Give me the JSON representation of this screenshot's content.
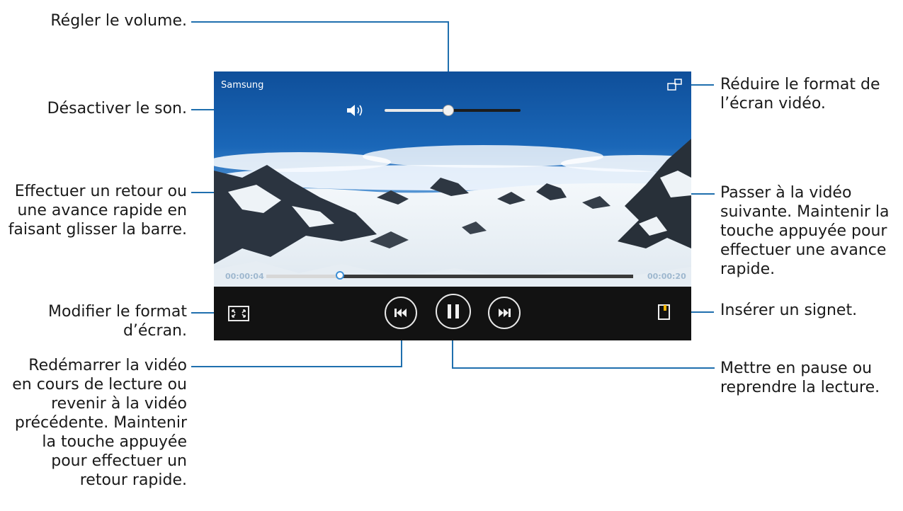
{
  "annotations": {
    "volume": "Régler le volume.",
    "mute": "Désactiver le son.",
    "seek": [
      "Effectuer un retour ou",
      "une avance rapide en",
      "faisant glisser la barre."
    ],
    "aspect": [
      "Modifier le format",
      "d’écran."
    ],
    "previous": [
      "Redémarrer la vidéo",
      "en cours de lecture ou",
      "revenir à la vidéo",
      "précédente. Maintenir",
      "la touche appuyée",
      "pour effectuer un",
      "retour rapide."
    ],
    "popup": [
      "Réduire le format de",
      "l’écran vidéo."
    ],
    "next": [
      "Passer à la vidéo",
      "suivante. Maintenir la",
      "touche appuyée pour",
      "effectuer une avance",
      "rapide."
    ],
    "bookmark": "Insérer un signet.",
    "pause": [
      "Mettre en pause ou",
      "reprendre la lecture."
    ]
  },
  "player": {
    "title": "Samsung",
    "elapsed": "00:00:04",
    "duration": "00:00:20",
    "volume_level": 0.47,
    "progress": 0.2,
    "state": "playing"
  },
  "colors": {
    "callout_line": "#1f6fae",
    "controls_bg": "#121212",
    "bookmark_accent": "#f0b400"
  },
  "icons": [
    "speaker-icon",
    "popup-player-icon",
    "aspect-ratio-icon",
    "previous-icon",
    "pause-icon",
    "next-icon",
    "bookmark-icon"
  ]
}
